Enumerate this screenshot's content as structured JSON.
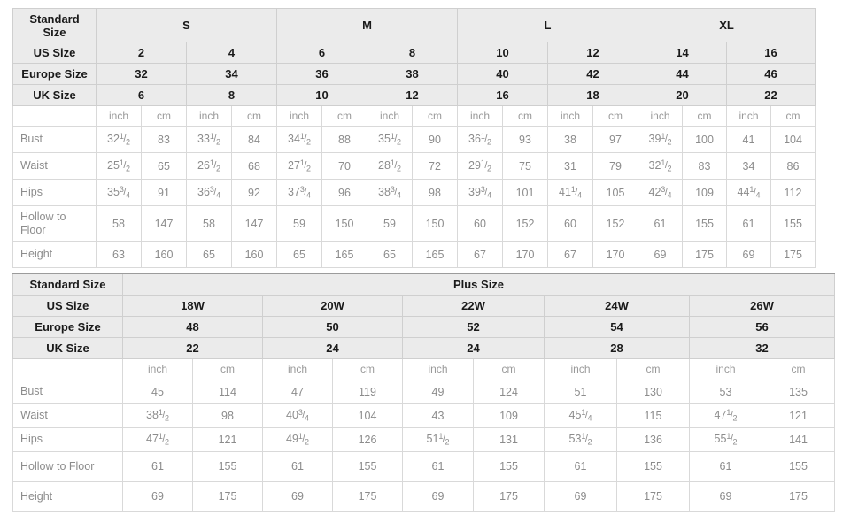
{
  "standard_table": {
    "label_standard_size": "Standard\nSize",
    "label_us_size": "US Size",
    "label_europe_size": "Europe Size",
    "label_uk_size": "UK Size",
    "unit_inch": "inch",
    "unit_cm": "cm",
    "size_groups": [
      "S",
      "M",
      "L",
      "XL"
    ],
    "us_sizes": [
      "2",
      "4",
      "6",
      "8",
      "10",
      "12",
      "14",
      "16"
    ],
    "europe_sizes": [
      "32",
      "34",
      "36",
      "38",
      "40",
      "42",
      "44",
      "46"
    ],
    "uk_sizes": [
      "6",
      "8",
      "10",
      "12",
      "16",
      "18",
      "20",
      "22"
    ],
    "rows": [
      {
        "label": "Bust",
        "inch": [
          "32 1/2",
          "33 1/2",
          "34 1/2",
          "35 1/2",
          "36 1/2",
          "38",
          "39 1/2",
          "41"
        ],
        "cm": [
          "83",
          "84",
          "88",
          "90",
          "93",
          "97",
          "100",
          "104"
        ]
      },
      {
        "label": "Waist",
        "inch": [
          "25 1/2",
          "26 1/2",
          "27 1/2",
          "28 1/2",
          "29 1/2",
          "31",
          "32 1/2",
          "34"
        ],
        "cm": [
          "65",
          "68",
          "70",
          "72",
          "75",
          "79",
          "83",
          "86"
        ]
      },
      {
        "label": "Hips",
        "inch": [
          "35 3/4",
          "36 3/4",
          "37 3/4",
          "38 3/4",
          "39 3/4",
          "41 1/4",
          "42 3/4",
          "44 1/4"
        ],
        "cm": [
          "91",
          "92",
          "96",
          "98",
          "101",
          "105",
          "109",
          "112"
        ]
      },
      {
        "label": "Hollow to Floor",
        "inch": [
          "58",
          "58",
          "59",
          "59",
          "60",
          "60",
          "61",
          "61"
        ],
        "cm": [
          "147",
          "147",
          "150",
          "150",
          "152",
          "152",
          "155",
          "155"
        ]
      },
      {
        "label": "Height",
        "inch": [
          "63",
          "65",
          "65",
          "65",
          "67",
          "67",
          "69",
          "69"
        ],
        "cm": [
          "160",
          "160",
          "165",
          "165",
          "170",
          "170",
          "175",
          "175"
        ]
      }
    ]
  },
  "plus_table": {
    "label_standard_size": "Standard Size",
    "label_plus_size": "Plus Size",
    "label_us_size": "US Size",
    "label_europe_size": "Europe Size",
    "label_uk_size": "UK Size",
    "unit_inch": "inch",
    "unit_cm": "cm",
    "us_sizes": [
      "18W",
      "20W",
      "22W",
      "24W",
      "26W"
    ],
    "europe_sizes": [
      "48",
      "50",
      "52",
      "54",
      "56"
    ],
    "uk_sizes": [
      "22",
      "24",
      "24",
      "28",
      "32"
    ],
    "rows": [
      {
        "label": "Bust",
        "inch": [
          "45",
          "47",
          "49",
          "51",
          "53"
        ],
        "cm": [
          "114",
          "119",
          "124",
          "130",
          "135"
        ]
      },
      {
        "label": "Waist",
        "inch": [
          "38 1/2",
          "40 3/4",
          "43",
          "45 1/4",
          "47 1/2"
        ],
        "cm": [
          "98",
          "104",
          "109",
          "115",
          "121"
        ]
      },
      {
        "label": "Hips",
        "inch": [
          "47 1/2",
          "49 1/2",
          "51 1/2",
          "53 1/2",
          "55 1/2"
        ],
        "cm": [
          "121",
          "126",
          "131",
          "136",
          "141"
        ]
      },
      {
        "label": "Hollow to Floor",
        "inch": [
          "61",
          "61",
          "61",
          "61",
          "61"
        ],
        "cm": [
          "155",
          "155",
          "155",
          "155",
          "155"
        ]
      },
      {
        "label": "Height",
        "inch": [
          "69",
          "69",
          "69",
          "69",
          "69"
        ],
        "cm": [
          "175",
          "175",
          "175",
          "175",
          "175"
        ]
      }
    ]
  },
  "colors": {
    "header_bg": "#ebebeb",
    "header_text": "#1a1a1a",
    "body_text": "#8c8c8c",
    "grid_line": "#d9d9d9",
    "header_grid_line": "#cfcfcf",
    "page_bg": "#ffffff"
  }
}
